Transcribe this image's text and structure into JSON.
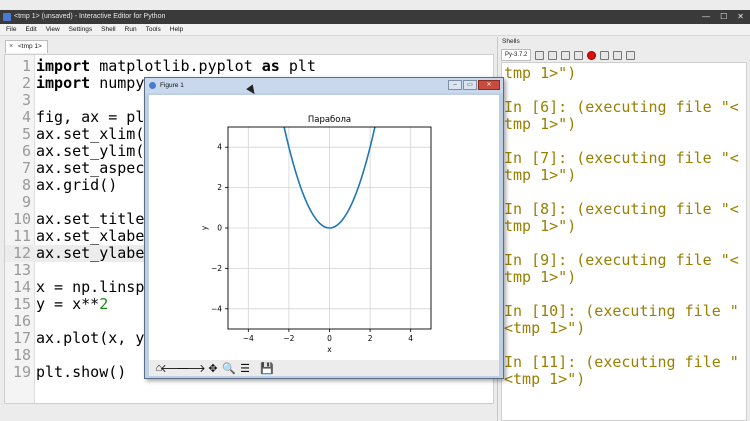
{
  "window": {
    "title": "<tmp 1> (unsaved) - Interactive Editor for Python"
  },
  "menubar": [
    "File",
    "Edit",
    "View",
    "Settings",
    "Shell",
    "Run",
    "Tools",
    "Help"
  ],
  "editor": {
    "tab_label": "<tmp 1>",
    "lines": [
      {
        "n": "1",
        "text": "import matplotlib.pyplot as plt"
      },
      {
        "n": "2",
        "text": "import numpy"
      },
      {
        "n": "3",
        "text": ""
      },
      {
        "n": "4",
        "text": "fig, ax = plt"
      },
      {
        "n": "5",
        "text": "ax.set_xlim("
      },
      {
        "n": "6",
        "text": "ax.set_ylim("
      },
      {
        "n": "7",
        "text": "ax.set_aspect"
      },
      {
        "n": "8",
        "text": "ax.grid()"
      },
      {
        "n": "9",
        "text": ""
      },
      {
        "n": "10",
        "text": "ax.set_title"
      },
      {
        "n": "11",
        "text": "ax.set_xlabel"
      },
      {
        "n": "12",
        "text": "ax.set_ylabel"
      },
      {
        "n": "13",
        "text": ""
      },
      {
        "n": "14",
        "text": "x = np.linspa"
      },
      {
        "n": "15",
        "text": "y = x**2"
      },
      {
        "n": "16",
        "text": ""
      },
      {
        "n": "17",
        "text": "ax.plot(x, y"
      },
      {
        "n": "18",
        "text": ""
      },
      {
        "n": "19",
        "text": "plt.show()"
      }
    ]
  },
  "shell": {
    "label": "Shells",
    "tab_label": "Py-3.7.2",
    "lines": [
      "tmp 1>\")",
      "",
      "In [6]: (executing file \"<",
      "tmp 1>\")",
      "",
      "In [7]: (executing file \"<",
      "tmp 1>\")",
      "",
      "In [8]: (executing file \"<",
      "tmp 1>\")",
      "",
      "In [9]: (executing file \"<",
      "tmp 1>\")",
      "",
      "In [10]: (executing file \"",
      "<tmp 1>\")",
      "",
      "In [11]: (executing file \"",
      "<tmp 1>\")"
    ]
  },
  "figure": {
    "window_title": "Figure 1",
    "toolbar_icons": [
      "home-icon",
      "back-arrow-icon",
      "forward-arrow-icon",
      "pan-icon",
      "zoom-icon",
      "configure-subplots-icon",
      "save-icon"
    ]
  },
  "chart_data": {
    "type": "line",
    "title": "Парабола",
    "xlabel": "x",
    "ylabel": "y",
    "xlim": [
      -5,
      5
    ],
    "ylim": [
      -5,
      5
    ],
    "xticks": [
      "−4",
      "−2",
      "0",
      "2",
      "4"
    ],
    "yticks": [
      "4",
      "2",
      "0",
      "−2",
      "−4"
    ],
    "grid": true,
    "series": [
      {
        "function": "y = x**2",
        "x_range": [
          -2.24,
          2.24
        ],
        "color": "#1f77b4"
      }
    ]
  }
}
